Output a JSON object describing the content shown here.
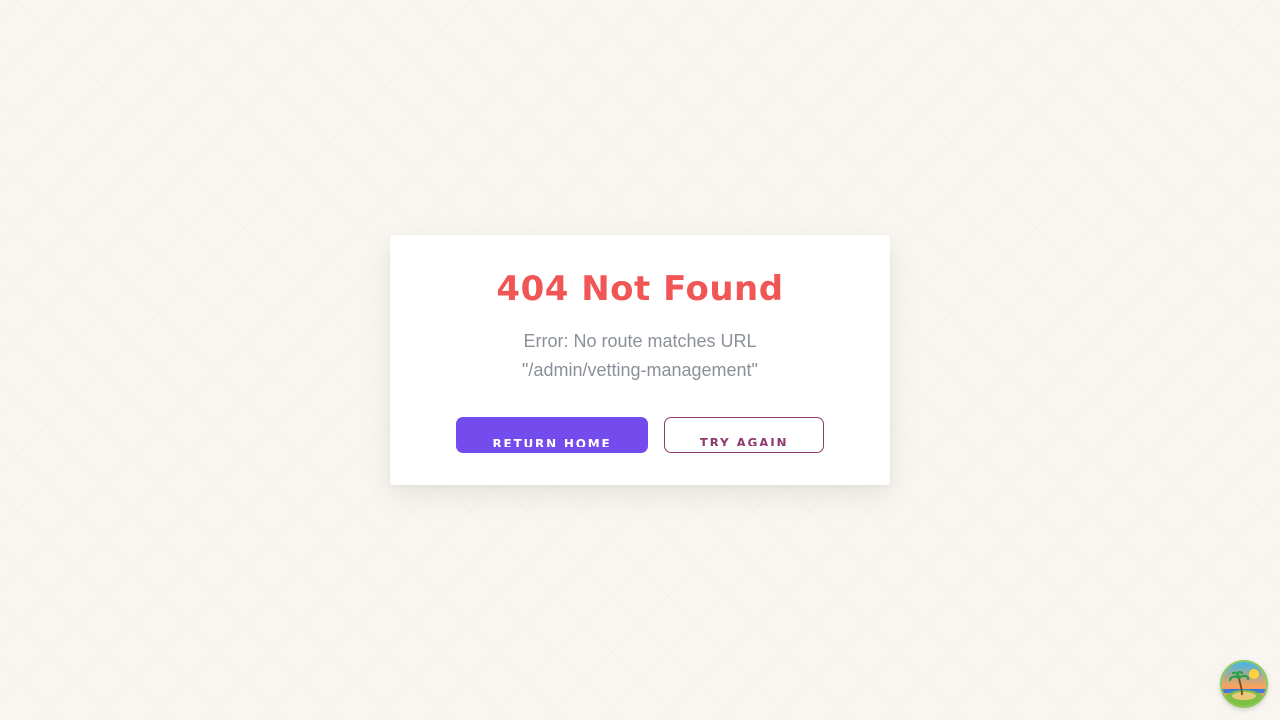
{
  "error": {
    "title": "404 Not Found",
    "message": "Error: No route matches URL \"/admin/vetting-management\""
  },
  "actions": {
    "return_home_label": "Return Home",
    "try_again_label": "Try Again"
  },
  "colors": {
    "background": "#f9f6f1",
    "title": "#f15656",
    "message": "#8a8f98",
    "primary_button": "#744ced",
    "outline_button": "#8e3c6e"
  },
  "icons": {
    "corner_badge": "island-sunset-icon"
  }
}
